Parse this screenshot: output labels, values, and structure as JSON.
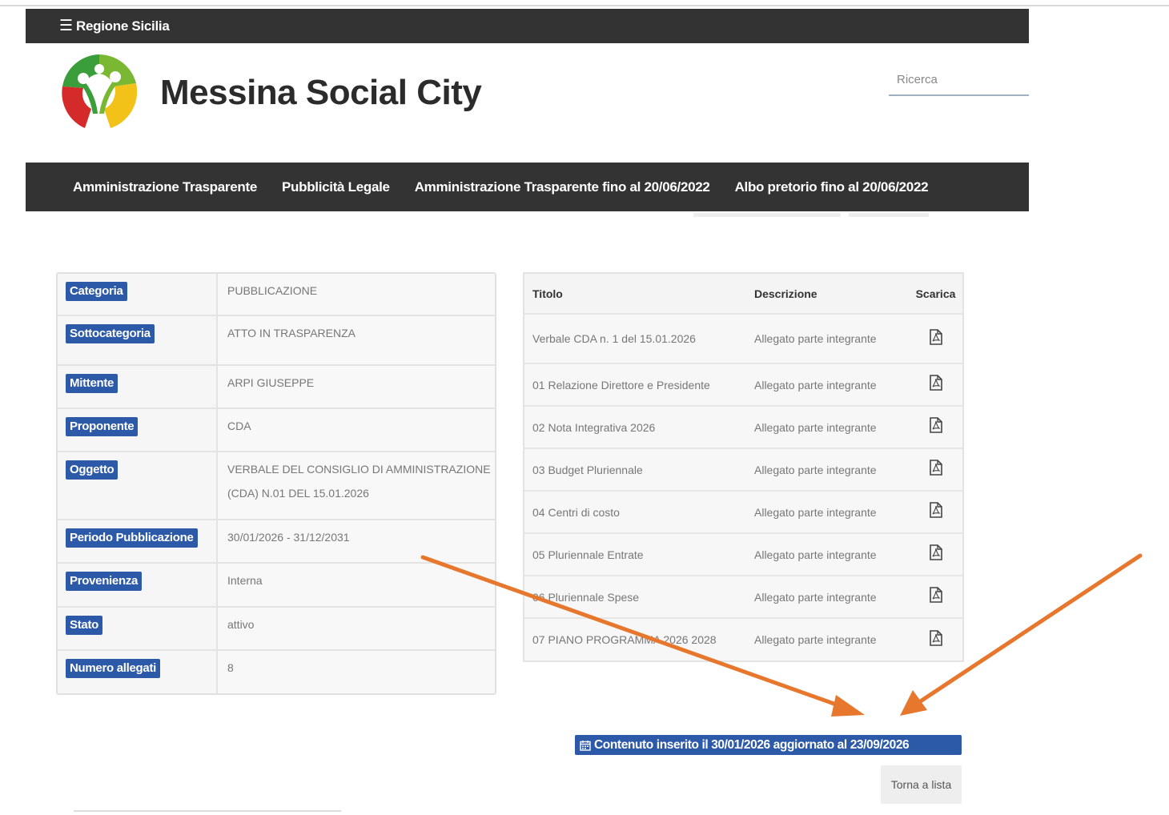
{
  "topbar": {
    "menu_icon": "hamburger-icon",
    "region": "Regione Sicilia"
  },
  "site": {
    "logo_icon": "messina-social-city-logo",
    "title": "Messina Social City"
  },
  "search": {
    "placeholder": "Ricerca"
  },
  "nav": [
    "Amministrazione Trasparente",
    "Pubblicità Legale",
    "Amministrazione Trasparente fino al 20/06/2022",
    "Albo pretorio fino al 20/06/2022"
  ],
  "details": [
    {
      "label": "Categoria",
      "value": "PUBBLICAZIONE"
    },
    {
      "label": "Sottocategoria",
      "value": "ATTO IN TRASPARENZA"
    },
    {
      "label": "Mittente",
      "value": "ARPI GIUSEPPE"
    },
    {
      "label": "Proponente",
      "value": "CDA"
    },
    {
      "label": "Oggetto",
      "value": "VERBALE DEL CONSIGLIO DI AMMINISTRAZIONE",
      "value2": "(CDA) N.01 DEL 15.01.2026"
    },
    {
      "label": "Periodo Pubblicazione",
      "value": "30/01/2026 - 31/12/2031"
    },
    {
      "label": "Provenienza",
      "value": "Interna"
    },
    {
      "label": "Stato",
      "value": "attivo"
    },
    {
      "label": "Numero allegati",
      "value": "8"
    }
  ],
  "attachments": {
    "headers": {
      "title": "Titolo",
      "description": "Descrizione",
      "download": "Scarica"
    },
    "download_icon": "pdf-file-icon",
    "rows": [
      {
        "title": "Verbale CDA n. 1 del 15.01.2026",
        "description": "Allegato parte integrante"
      },
      {
        "title": "01 Relazione Direttore e Presidente",
        "description": "Allegato parte integrante"
      },
      {
        "title": "02 Nota Integrativa 2026",
        "description": "Allegato parte integrante"
      },
      {
        "title": "03 Budget Pluriennale",
        "description": "Allegato parte integrante"
      },
      {
        "title": "04 Centri di costo",
        "description": "Allegato parte integrante"
      },
      {
        "title": "05 Pluriennale Entrate",
        "description": "Allegato parte integrante"
      },
      {
        "title": "06 Pluriennale Spese",
        "description": "Allegato parte integrante"
      },
      {
        "title": "07 PIANO PROGRAMMA 2026 2028",
        "description": "Allegato parte integrante"
      }
    ]
  },
  "info": {
    "calendar_icon": "calendar-icon",
    "text": "Contenuto inserito il 30/01/2026 aggiornato al 23/09/2026"
  },
  "back_button": "Torna a lista",
  "colors": {
    "dark_bar": "#333333",
    "badge_blue": "#2d5aa8",
    "annotation_arrow": "#e8772e"
  }
}
